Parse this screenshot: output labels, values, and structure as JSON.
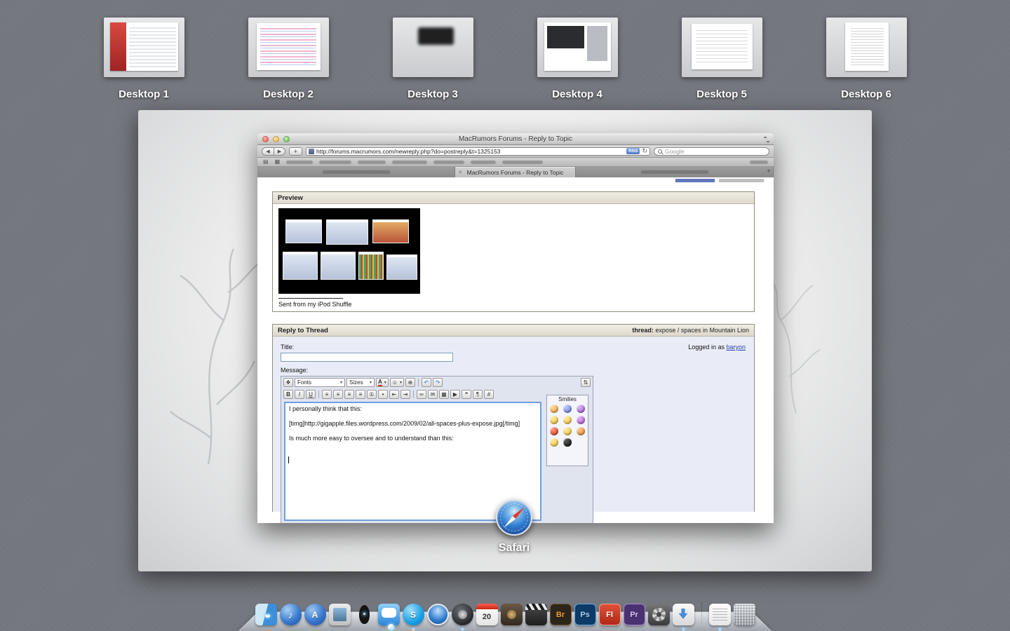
{
  "mission_control": {
    "spaces": [
      {
        "label": "Desktop 1"
      },
      {
        "label": "Desktop 2"
      },
      {
        "label": "Desktop 3"
      },
      {
        "label": "Desktop 4"
      },
      {
        "label": "Desktop 5"
      },
      {
        "label": "Desktop 6"
      }
    ],
    "app_label": "Safari"
  },
  "window": {
    "title": "MacRumors Forums - Reply to Topic",
    "toolbar": {
      "back_glyph": "◀",
      "forward_glyph": "▶",
      "new_tab_glyph": "+",
      "url": "http://forums.macrumors.com/newreply.php?do=postreply&t=1325153",
      "rss_badge": "RSS",
      "reload_glyph": "↻",
      "search_placeholder": "Google"
    },
    "bookmarks_bar": {
      "book_glyph": "▤",
      "grid_glyph": "▦"
    },
    "tabs": {
      "active_label": "MacRumors Forums - Reply to Topic",
      "close_glyph": "×",
      "add_glyph": "+"
    }
  },
  "page": {
    "preview": {
      "header": "Preview",
      "signature": "Sent from my iPod Shuffle"
    },
    "reply": {
      "header": "Reply to Thread",
      "thread_label": "thread:",
      "thread_value": "expose / spaces in Mountain Lion",
      "title_label": "Title:",
      "logged_in_prefix": "Logged in as",
      "username": "baryon",
      "message_label": "Message:",
      "editor": {
        "fonts_label": "Fonts",
        "sizes_label": "Sizes",
        "caret_glyph": "▾",
        "row1": [
          {
            "name": "remove-format",
            "glyph": "❖"
          },
          {
            "name": "font-color",
            "glyph": "A"
          },
          {
            "name": "smilie-menu",
            "glyph": "☺"
          },
          {
            "name": "attachment",
            "glyph": "⊕"
          },
          {
            "name": "undo",
            "glyph": "↶"
          },
          {
            "name": "redo",
            "glyph": "↷"
          },
          {
            "name": "editor-resize",
            "glyph": "⇅"
          }
        ],
        "row2": [
          {
            "name": "bold",
            "glyph": "B"
          },
          {
            "name": "italic",
            "glyph": "I"
          },
          {
            "name": "underline",
            "glyph": "U"
          },
          {
            "name": "align-left",
            "glyph": "≡"
          },
          {
            "name": "align-center",
            "glyph": "≡"
          },
          {
            "name": "align-right",
            "glyph": "≡"
          },
          {
            "name": "align-justify",
            "glyph": "≡"
          },
          {
            "name": "ordered-list",
            "glyph": "①"
          },
          {
            "name": "unordered-list",
            "glyph": "•"
          },
          {
            "name": "outdent",
            "glyph": "⇤"
          },
          {
            "name": "indent",
            "glyph": "⇥"
          },
          {
            "name": "insert-link",
            "glyph": "∞"
          },
          {
            "name": "insert-email",
            "glyph": "✉"
          },
          {
            "name": "insert-image",
            "glyph": "▦"
          },
          {
            "name": "insert-video",
            "glyph": "▶"
          },
          {
            "name": "quote",
            "glyph": "❝"
          },
          {
            "name": "code",
            "glyph": "¶"
          },
          {
            "name": "hash",
            "glyph": "#"
          }
        ],
        "message_text": "I personally think that this:\n\n[timg]http://gigapple.files.wordpress.com/2009/02/all-spaces-plus-expose.jpg[/timg]\n\nIs much more easy to oversee and to understand than this:",
        "smilies_title": "Smilies",
        "smilies": [
          "smile",
          "cool",
          "wink",
          "biggrin",
          "laugh",
          "tongue",
          "mad",
          "redface",
          "eek",
          "rolleyes",
          "apple"
        ]
      }
    }
  },
  "dock": {
    "items": [
      {
        "name": "finder",
        "running": true
      },
      {
        "name": "itunes",
        "glyph": "♪",
        "running": false
      },
      {
        "name": "app-store",
        "glyph": "A",
        "running": false
      },
      {
        "name": "preview-app",
        "running": false
      },
      {
        "name": "linux-tux",
        "running": true
      },
      {
        "name": "messages",
        "running": true
      },
      {
        "name": "skype",
        "glyph": "S",
        "running": true
      },
      {
        "name": "safari",
        "running": true
      },
      {
        "name": "steam",
        "running": true
      },
      {
        "name": "calendar",
        "glyph": "20",
        "running": false
      },
      {
        "name": "media-utility",
        "running": false
      },
      {
        "name": "imovie",
        "running": false
      },
      {
        "name": "adobe-bridge",
        "glyph": "Br",
        "running": false
      },
      {
        "name": "adobe-photoshop",
        "glyph": "Ps",
        "running": false
      },
      {
        "name": "adobe-flash",
        "glyph": "Fl",
        "running": false
      },
      {
        "name": "adobe-premiere",
        "glyph": "Pr",
        "running": false
      },
      {
        "name": "gear-utility",
        "running": false
      },
      {
        "name": "installer",
        "running": true
      },
      {
        "name": "notes",
        "running": true
      },
      {
        "name": "trash",
        "running": false
      }
    ]
  }
}
